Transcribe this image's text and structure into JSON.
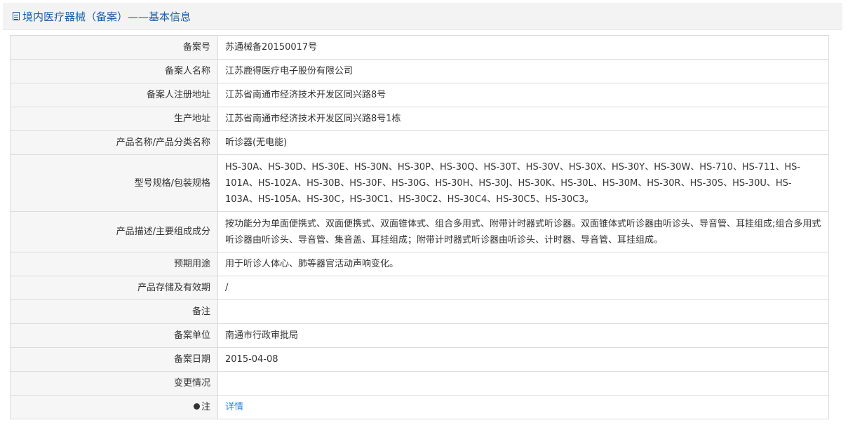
{
  "header": {
    "title": "境内医疗器械（备案）——基本信息",
    "accent_color": "#1a5fa8"
  },
  "rows": [
    {
      "label": "备案号",
      "value": "苏通械备20150017号"
    },
    {
      "label": "备案人名称",
      "value": "江苏鹿得医疗电子股份有限公司"
    },
    {
      "label": "备案人注册地址",
      "value": "江苏省南通市经济技术开发区同兴路8号"
    },
    {
      "label": "生产地址",
      "value": "江苏省南通市经济技术开发区同兴路8号1栋"
    },
    {
      "label": "产品名称/产品分类名称",
      "value": "听诊器(无电能)"
    },
    {
      "label": "型号规格/包装规格",
      "value": "HS-30A、HS-30D、HS-30E、HS-30N、HS-30P、HS-30Q、HS-30T、HS-30V、HS-30X、HS-30Y、HS-30W、HS-710、HS-711、HS-101A、HS-102A、HS-30B、HS-30F、HS-30G、HS-30H、HS-30J、HS-30K、HS-30L、HS-30M、HS-30R、HS-30S、HS-30U、HS-103A、HS-105A、HS-30C，HS-30C1、HS-30C2、HS-30C4、HS-30C5、HS-30C3。"
    },
    {
      "label": "产品描述/主要组成成分",
      "value": "按功能分为单面便携式、双面便携式、双面锥体式、组合多用式、附带计时器式听诊器。双面锥体式听诊器由听诊头、导音管、耳挂组成;组合多用式听诊器由听诊头、导音管、集音盖、耳挂组成；附带计时器式听诊器由听诊头、计时器、导音管、耳挂组成。"
    },
    {
      "label": "预期用途",
      "value": "用于听诊人体心、肺等器官活动声响变化。"
    },
    {
      "label": "产品存储及有效期",
      "value": "/"
    },
    {
      "label": "备注",
      "value": ""
    },
    {
      "label": "备案单位",
      "value": "南通市行政审批局"
    },
    {
      "label": "备案日期",
      "value": "2015-04-08"
    },
    {
      "label": "变更情况",
      "value": ""
    }
  ],
  "note": {
    "label": "注",
    "icon": "pin-icon",
    "link_text": "详情",
    "link_color": "#2a86d8"
  }
}
